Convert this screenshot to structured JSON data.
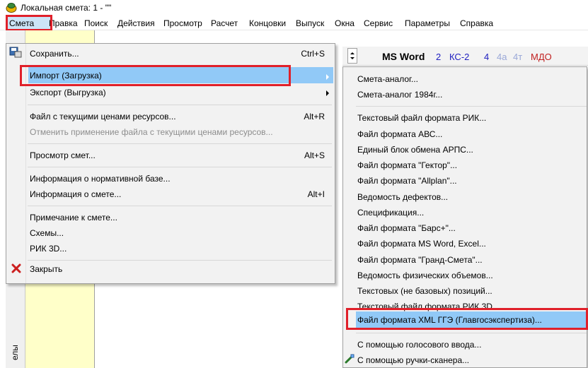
{
  "window": {
    "title": "Локальная смета: 1 - \"\""
  },
  "menubar": {
    "items": [
      "Смета",
      "Правка",
      "Поиск",
      "Действия",
      "Просмотр",
      "Расчет",
      "Концовки",
      "Выпуск",
      "Окна",
      "Сервис",
      "Параметры",
      "Справка"
    ]
  },
  "toolbar": {
    "msword": "MS Word",
    "b2": "2",
    "ks2": "КС-2",
    "b4": "4",
    "b4a": "4а",
    "b4t": "4т",
    "mdo": "МДО"
  },
  "left_panel": {
    "vertical_label": "елы"
  },
  "menu": {
    "save": "Сохранить...",
    "save_sc": "Ctrl+S",
    "import": "Импорт (Загрузка)",
    "export": "Экспорт (Выгрузка)",
    "prices_file": "Файл с текущими ценами ресурсов...",
    "prices_file_sc": "Alt+R",
    "cancel_prices": "Отменить применение файла с текущими ценами ресурсов...",
    "view_estimates": "Просмотр смет...",
    "view_estimates_sc": "Alt+S",
    "norm_info": "Информация о нормативной базе...",
    "estimate_info": "Информация о смете...",
    "estimate_info_sc": "Alt+I",
    "note": "Примечание к смете...",
    "schemes": "Схемы...",
    "rik3d": "РИК 3D...",
    "close": "Закрыть"
  },
  "submenu": {
    "items": [
      "Смета-аналог...",
      "Смета-аналог 1984г...",
      "Текстовый файл формата РИК...",
      "Файл формата АВС...",
      "Единый блок обмена АРПС...",
      "Файл формата \"Гектор\"...",
      "Файл формата \"Allplan\"...",
      "Ведомость дефектов...",
      "Спецификация...",
      "Файл формата \"Барс+\"...",
      "Файл формата MS Word, Excel...",
      "Файл формата \"Гранд-Смета\"...",
      "Ведомость физических объемов...",
      "Текстовых (не базовых) позиций...",
      "Текстовый файл формата РИК 3D...",
      "Файл формата XML ГГЭ (Главгосэкспертиза)...",
      "С помощью голосового ввода...",
      "С помощью ручки-сканера..."
    ]
  },
  "colors": {
    "highlight": "#91c9f7",
    "callout": "#e0202a",
    "panel": "#ffffc9"
  }
}
